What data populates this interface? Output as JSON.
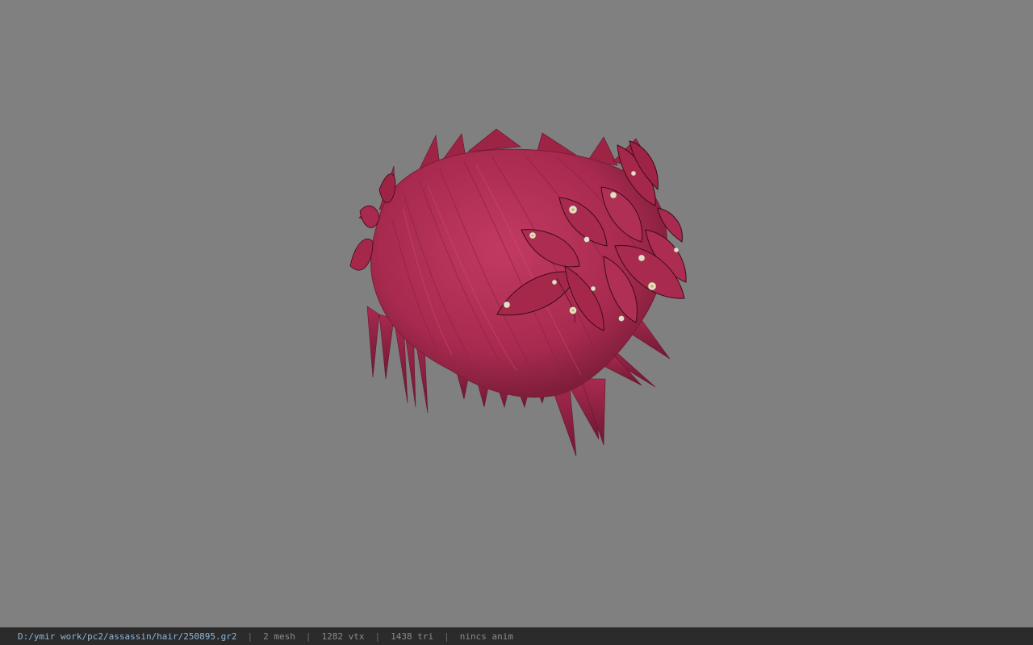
{
  "viewer": {
    "background_color": "#808080",
    "model": {
      "hair_color": "#b02c52",
      "flower_color": "#a5284a",
      "blossom_color": "#e8dcc8"
    }
  },
  "status_bar": {
    "file_path": "D:/ymir work/pc2/assassin/hair/250895.gr2",
    "separator": "|",
    "mesh": "2 mesh",
    "vertices": "1282 vtx",
    "triangles": "1438 tri",
    "anim": "nincs anim"
  }
}
